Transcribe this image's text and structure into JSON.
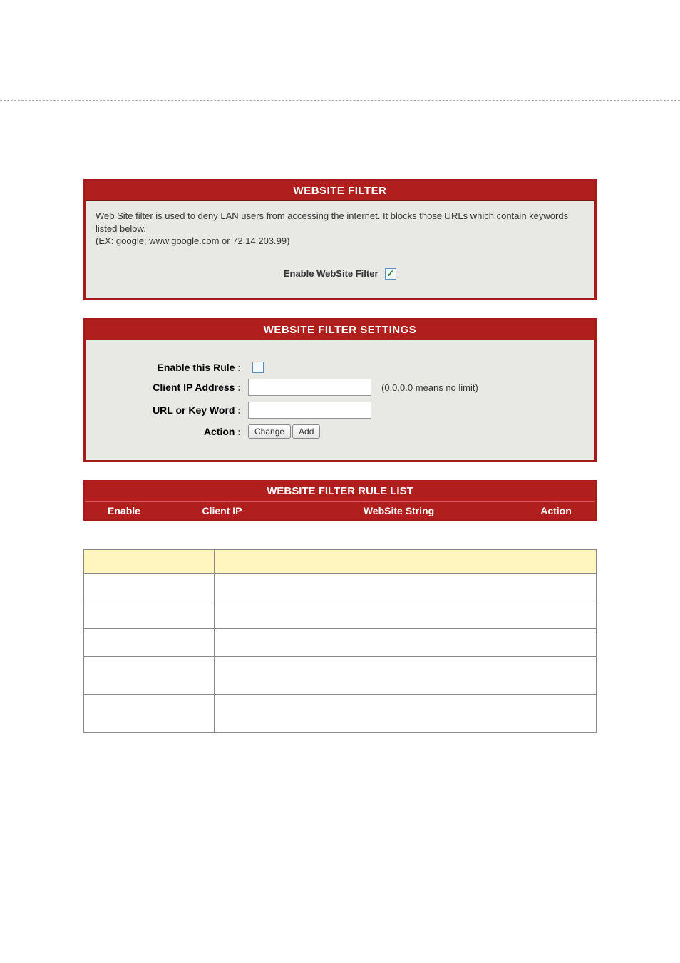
{
  "header1": {
    "title": "WEBSITE FILTER",
    "description": "Web Site filter is used to deny LAN users from accessing the internet. It blocks those URLs which contain keywords listed below.\n(EX: google; www.google.com or 72.14.203.99)",
    "enable_label": "Enable WebSite Filter",
    "enable_checked": true
  },
  "settings": {
    "title": "WEBSITE FILTER SETTINGS",
    "labels": {
      "enable_rule": "Enable this Rule :",
      "client_ip": "Client IP Address :",
      "url_keyword": "URL or Key Word :",
      "action": "Action :"
    },
    "values": {
      "enable_rule_checked": false,
      "client_ip": "",
      "url_keyword": ""
    },
    "hints": {
      "client_ip": "(0.0.0.0 means no limit)"
    },
    "buttons": {
      "change": "Change",
      "add": "Add"
    }
  },
  "rule_list": {
    "title": "WEBSITE FILTER RULE LIST",
    "columns": {
      "enable": "Enable",
      "client_ip": "Client IP",
      "website_string": "WebSite String",
      "action": "Action"
    },
    "rows": []
  }
}
